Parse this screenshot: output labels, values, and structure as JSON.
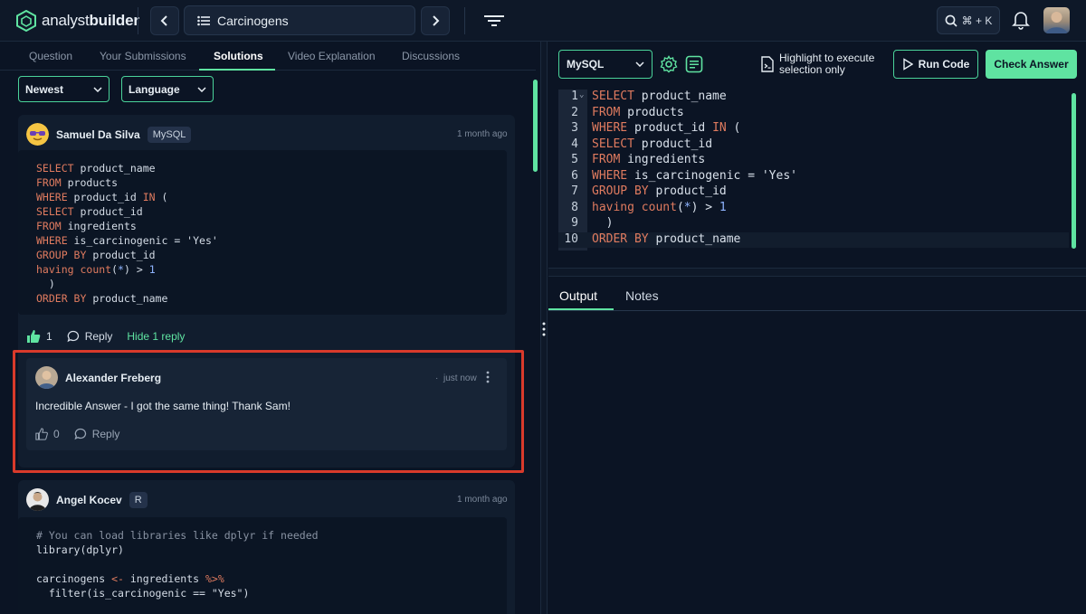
{
  "app": {
    "brand_light": "analyst",
    "brand_bold": "builder",
    "problem_title": "Carcinogens",
    "search_shortcut": "⌘ + K"
  },
  "tabs": [
    "Question",
    "Your Submissions",
    "Solutions",
    "Video Explanation",
    "Discussions"
  ],
  "filters": {
    "sort": "Newest",
    "language": "Language"
  },
  "solutions": [
    {
      "author": "Samuel Da Silva",
      "language_badge": "MySQL",
      "time": "1 month ago",
      "likes": "1",
      "reply_label": "Reply",
      "hide_replies_label": "Hide 1 reply",
      "code_lines": [
        "SELECT product_name",
        "FROM products",
        "WHERE product_id IN (",
        "SELECT product_id",
        "FROM ingredients",
        "WHERE is_carcinogenic = 'Yes'",
        "GROUP BY product_id",
        "having count(*) > 1",
        "  )",
        "ORDER BY product_name"
      ],
      "reply": {
        "author": "Alexander Freberg",
        "time": "just now",
        "text": "Incredible Answer - I got the same thing! Thank Sam!",
        "likes": "0",
        "reply_label": "Reply"
      }
    },
    {
      "author": "Angel Kocev",
      "language_badge": "R",
      "time": "1 month ago",
      "code_lines": [
        "# You can load libraries like dplyr if needed",
        "library(dplyr)",
        "",
        "carcinogens <- ingredients %>%",
        "  filter(is_carcinogenic == \"Yes\")"
      ]
    }
  ],
  "editor": {
    "language": "MySQL",
    "highlight_hint_1": "Highlight to execute",
    "highlight_hint_2": "selection only",
    "run_label": "Run Code",
    "check_label": "Check Answer",
    "line_numbers": [
      "1",
      "2",
      "3",
      "4",
      "5",
      "6",
      "7",
      "8",
      "9",
      "10"
    ],
    "lines": [
      "SELECT product_name",
      "FROM products",
      "WHERE product_id IN (",
      "SELECT product_id",
      "FROM ingredients",
      "WHERE is_carcinogenic = 'Yes'",
      "GROUP BY product_id",
      "having count(*) > 1",
      "  )",
      "ORDER BY product_name"
    ]
  },
  "output_tabs": {
    "output": "Output",
    "notes": "Notes"
  },
  "colors": {
    "accent": "#5fe3a1",
    "highlight_border": "#d93a2b",
    "keyword": "#e07b5f",
    "number": "#8fb4ff"
  }
}
